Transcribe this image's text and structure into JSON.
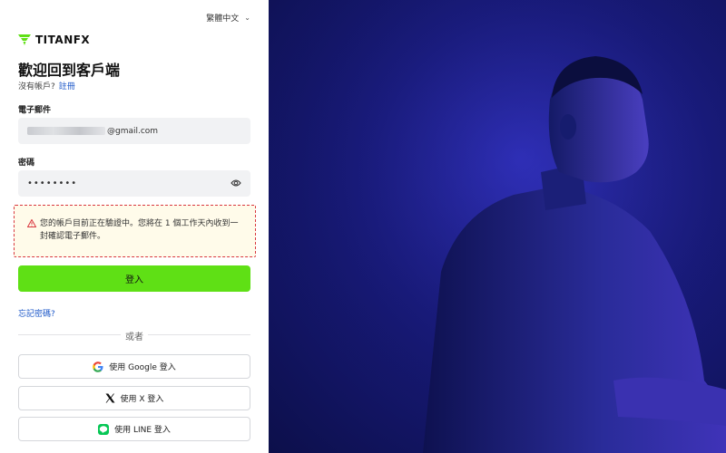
{
  "language": {
    "label": "繁體中文"
  },
  "logo": {
    "text": "TITANFX"
  },
  "login": {
    "title": "歡迎回到客戶端",
    "no_account": "沒有帳戶?",
    "register_link": "註冊",
    "email_label": "電子郵件",
    "email_suffix": "@gmail.com",
    "password_label": "密碼",
    "password_value": "••••••••",
    "alert_message": "您的帳戶目前正在驗證中。您將在 1 個工作天內收到一封確認電子郵件。",
    "login_button": "登入",
    "forgot_password": "忘記密碼?",
    "or_divider": "或者",
    "google_button": "使用 Google 登入",
    "x_button": "使用 X 登入",
    "line_button": "使用 LINE 登入"
  },
  "colors": {
    "accent_green": "#5fe015",
    "link_blue": "#1a56c8",
    "alert_border": "#d9363e",
    "hero_blue": "#181a7a"
  }
}
